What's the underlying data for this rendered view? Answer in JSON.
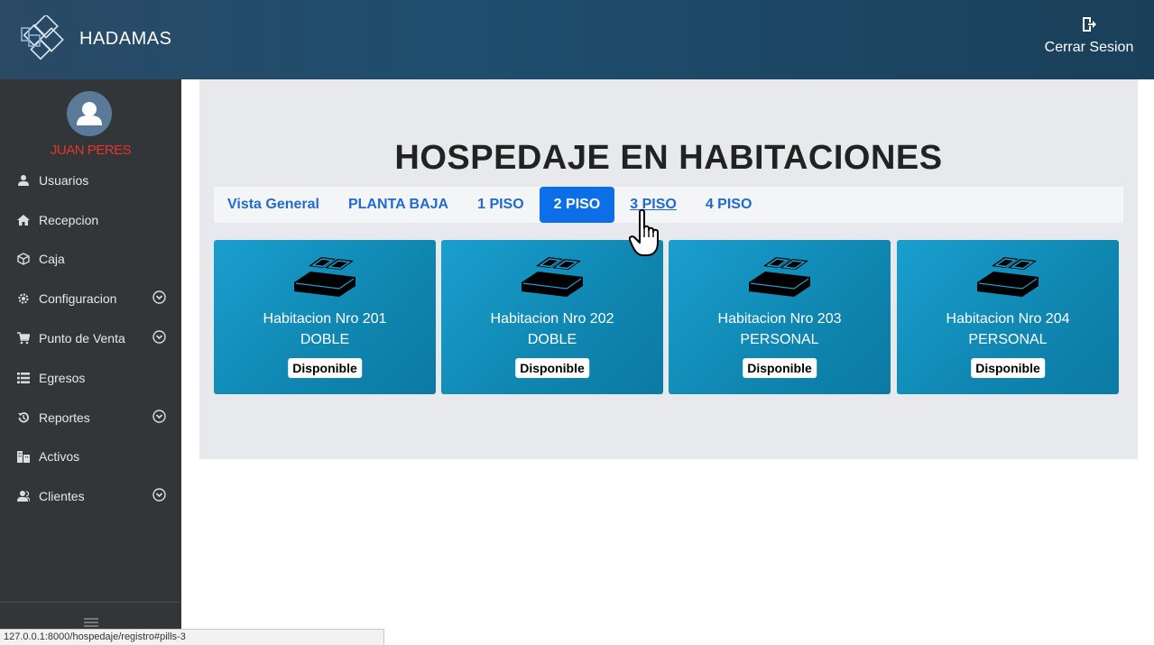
{
  "header": {
    "brand_name": "HADAMAS",
    "logout_label": "Cerrar Sesion",
    "logout_icon": "sign-out-icon",
    "logo_icon": "diamond-logo-icon"
  },
  "sidebar": {
    "user_name": "JUAN PERES",
    "avatar_icon": "user-avatar-icon",
    "items": [
      {
        "label": "Usuarios",
        "icon": "user-icon",
        "has_submenu": false
      },
      {
        "label": "Recepcion",
        "icon": "home-icon",
        "has_submenu": false
      },
      {
        "label": "Caja",
        "icon": "cube-icon",
        "has_submenu": false
      },
      {
        "label": "Configuracion",
        "icon": "gear-icon",
        "has_submenu": true
      },
      {
        "label": "Punto de Venta",
        "icon": "cart-icon",
        "has_submenu": true
      },
      {
        "label": "Egresos",
        "icon": "list-icon",
        "has_submenu": false
      },
      {
        "label": "Reportes",
        "icon": "history-icon",
        "has_submenu": true
      },
      {
        "label": "Activos",
        "icon": "building-icon",
        "has_submenu": false
      },
      {
        "label": "Clientes",
        "icon": "users-icon",
        "has_submenu": true
      }
    ]
  },
  "main": {
    "title": "HOSPEDAJE EN HABITACIONES",
    "tabs": [
      {
        "label": "Vista General",
        "active": false
      },
      {
        "label": "PLANTA BAJA",
        "active": false
      },
      {
        "label": "1 PISO",
        "active": false
      },
      {
        "label": "2 PISO",
        "active": true
      },
      {
        "label": "3 PISO",
        "active": false,
        "hovered": true
      },
      {
        "label": "4 PISO",
        "active": false
      }
    ],
    "rooms": [
      {
        "name": "Habitacion Nro 201",
        "type": "DOBLE",
        "status": "Disponible",
        "icon": "bed-icon"
      },
      {
        "name": "Habitacion Nro 202",
        "type": "DOBLE",
        "status": "Disponible",
        "icon": "bed-icon"
      },
      {
        "name": "Habitacion Nro 203",
        "type": "PERSONAL",
        "status": "Disponible",
        "icon": "bed-icon"
      },
      {
        "name": "Habitacion Nro 204",
        "type": "PERSONAL",
        "status": "Disponible",
        "icon": "bed-icon"
      }
    ]
  },
  "statusbar": {
    "url": "127.0.0.1:8000/hospedaje/registro#pills-3"
  },
  "colors": {
    "header_bg": "#1f4e6e",
    "sidebar_bg": "#333638",
    "user_name": "#e8322a",
    "tab_text": "#1f6bd1",
    "tab_active_bg": "#0d6fe8",
    "card_bg": "#1390c0"
  }
}
